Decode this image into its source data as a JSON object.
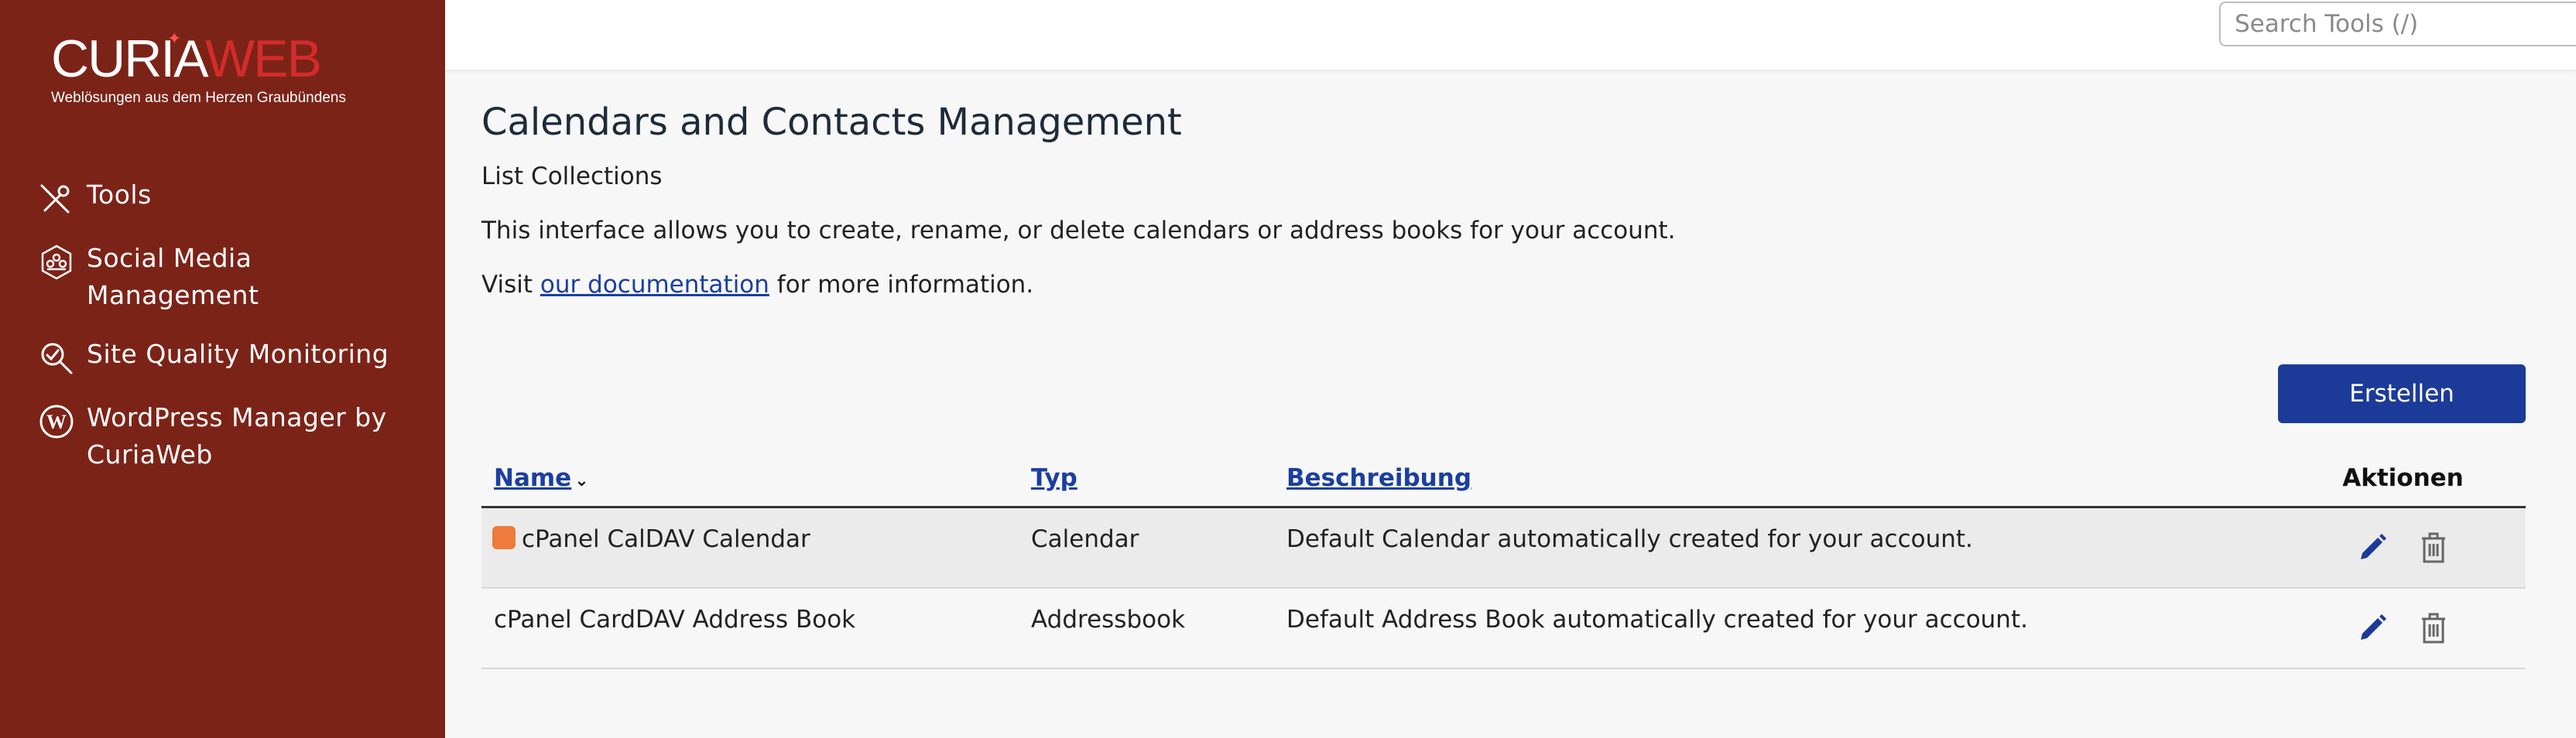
{
  "brand": {
    "word_part1": "CURIA",
    "word_part2": "WEB",
    "tagline": "Weblösungen aus dem Herzen Graubündens"
  },
  "sidebar": {
    "items": [
      {
        "label": "Tools",
        "icon": "tools-icon"
      },
      {
        "label": "Social Media Management",
        "icon": "social-media-icon"
      },
      {
        "label": "Site Quality Monitoring",
        "icon": "site-quality-icon"
      },
      {
        "label": "WordPress Manager by CuriaWeb",
        "icon": "wordpress-icon"
      }
    ]
  },
  "search": {
    "placeholder": "Search Tools (/)"
  },
  "page": {
    "title": "Calendars and Contacts Management",
    "subtitle": "List Collections",
    "description": "This interface allows you to create, rename, or delete calendars or address books for your account.",
    "visit_prefix": "Visit ",
    "visit_link": "our documentation",
    "visit_suffix": " for more information."
  },
  "toolbar": {
    "create_label": "Erstellen"
  },
  "table": {
    "headers": {
      "name": "Name",
      "type": "Typ",
      "description": "Beschreibung",
      "actions": "Aktionen"
    },
    "rows": [
      {
        "name": "cPanel CalDAV Calendar",
        "type": "Calendar",
        "description": "Default Calendar automatically created for your account.",
        "color": "#ee7a3c"
      },
      {
        "name": "cPanel CardDAV Address Book",
        "type": "Addressbook",
        "description": "Default Address Book automatically created for your account."
      }
    ]
  },
  "colors": {
    "sidebar_bg": "#7c2318",
    "primary": "#1c3a98",
    "link": "#1a3fa0"
  }
}
